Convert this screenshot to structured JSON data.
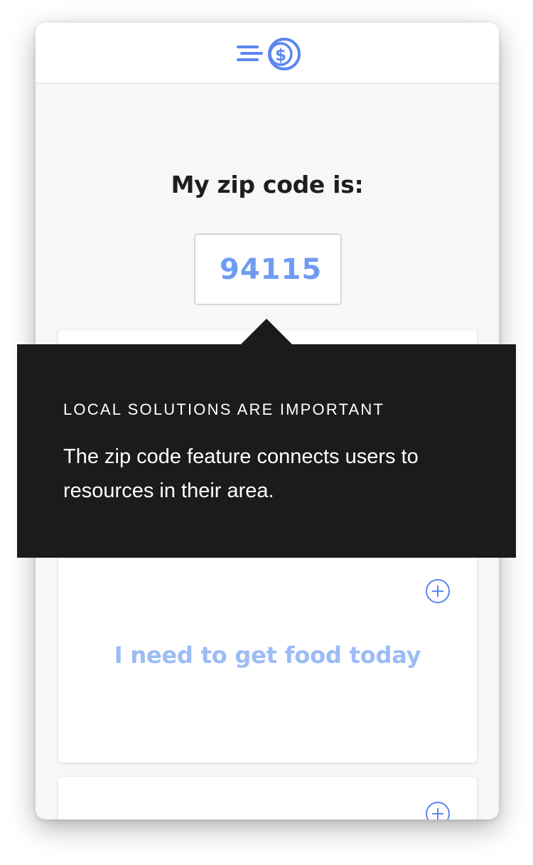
{
  "header": {
    "logo_icon": "coin-speed-icon",
    "brand_color": "#5b86f0"
  },
  "zip": {
    "title": "My zip code is:",
    "value": "94115"
  },
  "tooltip": {
    "heading": "LOCAL SOLUTIONS ARE IMPORTANT",
    "body": "The zip code feature connects users to resources in their area."
  },
  "cards": [
    {
      "label": "I need to get food today",
      "icon": "plus-circle-icon"
    },
    {
      "label": "",
      "icon": "plus-circle-icon"
    }
  ],
  "colors": {
    "accent": "#6f9cf2",
    "accent_light": "#9bbcf5",
    "tooltip_bg": "#1b1b1d"
  }
}
